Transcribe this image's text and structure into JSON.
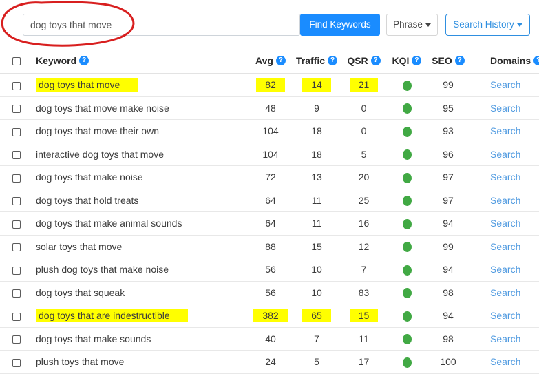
{
  "search": {
    "query_value": "dog toys that move",
    "placeholder": "",
    "find_button": "Find Keywords",
    "match_type": "Phrase",
    "history_button": "Search History"
  },
  "table": {
    "columns": [
      {
        "key": "checkbox",
        "label": ""
      },
      {
        "key": "keyword",
        "label": "Keyword",
        "help": "?"
      },
      {
        "key": "avg",
        "label": "Avg",
        "help": "?"
      },
      {
        "key": "traffic",
        "label": "Traffic",
        "help": "?"
      },
      {
        "key": "qsr",
        "label": "QSR",
        "help": "?"
      },
      {
        "key": "kqi",
        "label": "KQI",
        "help": "?"
      },
      {
        "key": "seo",
        "label": "SEO",
        "help": "?"
      },
      {
        "key": "domains",
        "label": "Domains",
        "help": "?"
      }
    ],
    "row_action_label": "Search",
    "rows": [
      {
        "keyword": "dog toys that move",
        "avg": "82",
        "traffic": "14",
        "qsr": "21",
        "kqi": "green",
        "seo": "99",
        "domains": "Search",
        "highlighted": true
      },
      {
        "keyword": "dog toys that move make noise",
        "avg": "48",
        "traffic": "9",
        "qsr": "0",
        "kqi": "green",
        "seo": "95",
        "domains": "Search",
        "highlighted": false
      },
      {
        "keyword": "dog toys that move their own",
        "avg": "104",
        "traffic": "18",
        "qsr": "0",
        "kqi": "green",
        "seo": "93",
        "domains": "Search",
        "highlighted": false
      },
      {
        "keyword": "interactive dog toys that move",
        "avg": "104",
        "traffic": "18",
        "qsr": "5",
        "kqi": "green",
        "seo": "96",
        "domains": "Search",
        "highlighted": false
      },
      {
        "keyword": "dog toys that make noise",
        "avg": "72",
        "traffic": "13",
        "qsr": "20",
        "kqi": "green",
        "seo": "97",
        "domains": "Search",
        "highlighted": false
      },
      {
        "keyword": "dog toys that hold treats",
        "avg": "64",
        "traffic": "11",
        "qsr": "25",
        "kqi": "green",
        "seo": "97",
        "domains": "Search",
        "highlighted": false
      },
      {
        "keyword": "dog toys that make animal sounds",
        "avg": "64",
        "traffic": "11",
        "qsr": "16",
        "kqi": "green",
        "seo": "94",
        "domains": "Search",
        "highlighted": false
      },
      {
        "keyword": "solar toys that move",
        "avg": "88",
        "traffic": "15",
        "qsr": "12",
        "kqi": "green",
        "seo": "99",
        "domains": "Search",
        "highlighted": false
      },
      {
        "keyword": "plush dog toys that make noise",
        "avg": "56",
        "traffic": "10",
        "qsr": "7",
        "kqi": "green",
        "seo": "94",
        "domains": "Search",
        "highlighted": false
      },
      {
        "keyword": "dog toys that squeak",
        "avg": "56",
        "traffic": "10",
        "qsr": "83",
        "kqi": "green",
        "seo": "98",
        "domains": "Search",
        "highlighted": false
      },
      {
        "keyword": "dog toys that are indestructible",
        "avg": "382",
        "traffic": "65",
        "qsr": "15",
        "kqi": "green",
        "seo": "94",
        "domains": "Search",
        "highlighted": true
      },
      {
        "keyword": "dog toys that make sounds",
        "avg": "40",
        "traffic": "7",
        "qsr": "11",
        "kqi": "green",
        "seo": "98",
        "domains": "Search",
        "highlighted": false
      },
      {
        "keyword": "plush toys that move",
        "avg": "24",
        "traffic": "5",
        "qsr": "17",
        "kqi": "green",
        "seo": "100",
        "domains": "Search",
        "highlighted": false
      }
    ]
  },
  "annotations": {
    "oval_color": "#d81f1f",
    "highlight_color": "#ffff00"
  },
  "colors": {
    "accent_blue": "#1a8cff",
    "link_blue": "#4f9ae0",
    "kqi_green": "#41a944"
  }
}
